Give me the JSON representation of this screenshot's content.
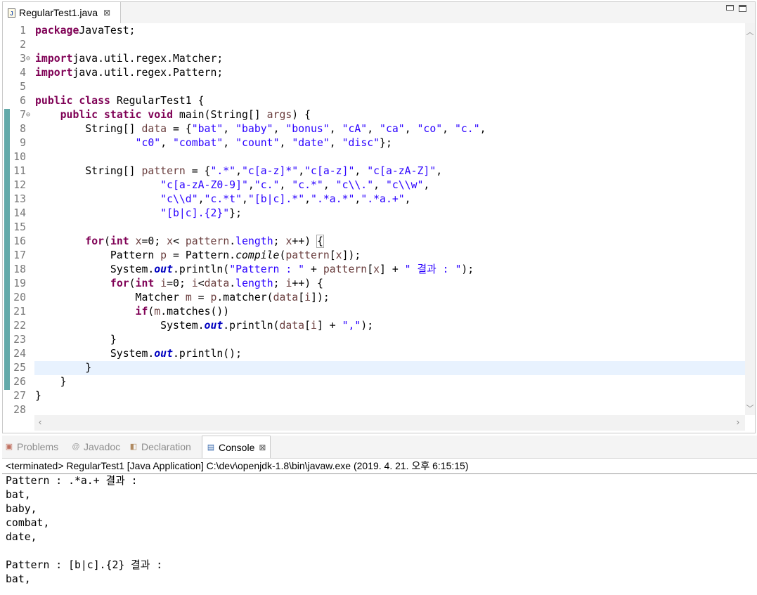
{
  "editor": {
    "tab_title": "RegularTest1.java",
    "lines": [
      {
        "n": "1",
        "fold": "",
        "segs": [
          [
            "kw",
            "package"
          ],
          [
            "",
            "JavaTest;"
          ]
        ]
      },
      {
        "n": "2",
        "fold": "",
        "segs": []
      },
      {
        "n": "3",
        "fold": "⊖",
        "segs": [
          [
            "kw",
            "import"
          ],
          [
            "",
            "java.util.regex.Matcher;"
          ]
        ]
      },
      {
        "n": "4",
        "fold": "",
        "segs": [
          [
            "kw",
            "import"
          ],
          [
            "",
            "java.util.regex.Pattern;"
          ]
        ]
      },
      {
        "n": "5",
        "fold": "",
        "segs": []
      },
      {
        "n": "6",
        "fold": "",
        "segs": [
          [
            "kw",
            "public class"
          ],
          [
            "",
            " RegularTest1 {"
          ]
        ]
      },
      {
        "n": "7",
        "fold": "⊖",
        "segs": [
          [
            "",
            "    "
          ],
          [
            "kw",
            "public static void"
          ],
          [
            "",
            " main(String[] "
          ],
          [
            "var",
            "args"
          ],
          [
            "",
            ") {"
          ]
        ]
      },
      {
        "n": "8",
        "fold": "",
        "segs": [
          [
            "",
            "        String[] "
          ],
          [
            "var",
            "data"
          ],
          [
            "",
            " = {"
          ],
          [
            "str",
            "\"bat\""
          ],
          [
            "",
            ", "
          ],
          [
            "str",
            "\"baby\""
          ],
          [
            "",
            ", "
          ],
          [
            "str",
            "\"bonus\""
          ],
          [
            "",
            ", "
          ],
          [
            "str",
            "\"cA\""
          ],
          [
            "",
            ", "
          ],
          [
            "str",
            "\"ca\""
          ],
          [
            "",
            ", "
          ],
          [
            "str",
            "\"co\""
          ],
          [
            "",
            ", "
          ],
          [
            "str",
            "\"c.\""
          ],
          [
            "",
            ","
          ]
        ]
      },
      {
        "n": "9",
        "fold": "",
        "segs": [
          [
            "",
            "                "
          ],
          [
            "str",
            "\"c0\""
          ],
          [
            "",
            ", "
          ],
          [
            "str",
            "\"combat\""
          ],
          [
            "",
            ", "
          ],
          [
            "str",
            "\"count\""
          ],
          [
            "",
            ", "
          ],
          [
            "str",
            "\"date\""
          ],
          [
            "",
            ", "
          ],
          [
            "str",
            "\"disc\""
          ],
          [
            "",
            "};"
          ]
        ]
      },
      {
        "n": "10",
        "fold": "",
        "segs": []
      },
      {
        "n": "11",
        "fold": "",
        "segs": [
          [
            "",
            "        String[] "
          ],
          [
            "var",
            "pattern"
          ],
          [
            "",
            " = {"
          ],
          [
            "str",
            "\".*\""
          ],
          [
            "",
            ","
          ],
          [
            "str",
            "\"c[a-z]*\""
          ],
          [
            "",
            ","
          ],
          [
            "str",
            "\"c[a-z]\""
          ],
          [
            "",
            ", "
          ],
          [
            "str",
            "\"c[a-zA-Z]\""
          ],
          [
            "",
            ","
          ]
        ]
      },
      {
        "n": "12",
        "fold": "",
        "segs": [
          [
            "",
            "                    "
          ],
          [
            "str",
            "\"c[a-zA-Z0-9]\""
          ],
          [
            "",
            ","
          ],
          [
            "str",
            "\"c.\""
          ],
          [
            "",
            ", "
          ],
          [
            "str",
            "\"c.*\""
          ],
          [
            "",
            ", "
          ],
          [
            "str",
            "\"c\\\\.\""
          ],
          [
            "",
            ", "
          ],
          [
            "str",
            "\"c\\\\w\""
          ],
          [
            "",
            ","
          ]
        ]
      },
      {
        "n": "13",
        "fold": "",
        "segs": [
          [
            "",
            "                    "
          ],
          [
            "str",
            "\"c\\\\d\""
          ],
          [
            "",
            ","
          ],
          [
            "str",
            "\"c.*t\""
          ],
          [
            "",
            ","
          ],
          [
            "str",
            "\"[b|c].*\""
          ],
          [
            "",
            ","
          ],
          [
            "str",
            "\".*a.*\""
          ],
          [
            "",
            ","
          ],
          [
            "str",
            "\".*a.+\""
          ],
          [
            "",
            ","
          ]
        ]
      },
      {
        "n": "14",
        "fold": "",
        "segs": [
          [
            "",
            "                    "
          ],
          [
            "str",
            "\"[b|c].{2}\""
          ],
          [
            "",
            "};"
          ]
        ]
      },
      {
        "n": "15",
        "fold": "",
        "segs": []
      },
      {
        "n": "16",
        "fold": "",
        "segs": [
          [
            "",
            "        "
          ],
          [
            "kw",
            "for"
          ],
          [
            "",
            "("
          ],
          [
            "kw",
            "int"
          ],
          [
            "",
            ""
          ],
          [
            "var",
            " x"
          ],
          [
            "",
            "=0; "
          ],
          [
            "var",
            "x"
          ],
          [
            "",
            "< "
          ],
          [
            "var",
            "pattern"
          ],
          [
            "",
            "."
          ],
          [
            "fldp",
            "length"
          ],
          [
            "",
            "; "
          ],
          [
            "var",
            "x"
          ],
          [
            "",
            "++) "
          ],
          [
            "brk",
            "{"
          ]
        ]
      },
      {
        "n": "17",
        "fold": "",
        "segs": [
          [
            "",
            "            Pattern "
          ],
          [
            "var",
            "p"
          ],
          [
            "",
            " = Pattern."
          ],
          [
            "ital",
            "compile"
          ],
          [
            "",
            "("
          ],
          [
            "var",
            "pattern"
          ],
          [
            "",
            "["
          ],
          [
            "var",
            "x"
          ],
          [
            "",
            "]);"
          ]
        ]
      },
      {
        "n": "18",
        "fold": "",
        "segs": [
          [
            "",
            "            System."
          ],
          [
            "fld",
            "out"
          ],
          [
            "",
            ".println("
          ],
          [
            "str",
            "\"Pattern : \""
          ],
          [
            "",
            " + "
          ],
          [
            "var",
            "pattern"
          ],
          [
            "",
            "["
          ],
          [
            "var",
            "x"
          ],
          [
            "",
            "] + "
          ],
          [
            "str",
            "\" 결과 : \""
          ],
          [
            "",
            ");"
          ]
        ]
      },
      {
        "n": "19",
        "fold": "",
        "segs": [
          [
            "",
            "            "
          ],
          [
            "kw",
            "for"
          ],
          [
            "",
            "("
          ],
          [
            "kw",
            "int"
          ],
          [
            "",
            ""
          ],
          [
            "var",
            " i"
          ],
          [
            "",
            "=0; "
          ],
          [
            "var",
            "i"
          ],
          [
            "",
            "<"
          ],
          [
            "var",
            "data"
          ],
          [
            "",
            "."
          ],
          [
            "fldp",
            "length"
          ],
          [
            "",
            "; "
          ],
          [
            "var",
            "i"
          ],
          [
            "",
            "++) {"
          ]
        ]
      },
      {
        "n": "20",
        "fold": "",
        "segs": [
          [
            "",
            "                Matcher "
          ],
          [
            "var",
            "m"
          ],
          [
            "",
            " = "
          ],
          [
            "var",
            "p"
          ],
          [
            "",
            ".matcher("
          ],
          [
            "var",
            "data"
          ],
          [
            "",
            "["
          ],
          [
            "var",
            "i"
          ],
          [
            "",
            "]);"
          ]
        ]
      },
      {
        "n": "21",
        "fold": "",
        "segs": [
          [
            "",
            "                "
          ],
          [
            "kw",
            "if"
          ],
          [
            "",
            "("
          ],
          [
            "var",
            "m"
          ],
          [
            "",
            ".matches())"
          ]
        ]
      },
      {
        "n": "22",
        "fold": "",
        "segs": [
          [
            "",
            "                    System."
          ],
          [
            "fld",
            "out"
          ],
          [
            "",
            ".println("
          ],
          [
            "var",
            "data"
          ],
          [
            "",
            "["
          ],
          [
            "var",
            "i"
          ],
          [
            "",
            "] + "
          ],
          [
            "str",
            "\",\""
          ],
          [
            "",
            ");"
          ]
        ]
      },
      {
        "n": "23",
        "fold": "",
        "segs": [
          [
            "",
            "            }"
          ]
        ]
      },
      {
        "n": "24",
        "fold": "",
        "segs": [
          [
            "",
            "            System."
          ],
          [
            "fld",
            "out"
          ],
          [
            "",
            ".println();"
          ]
        ]
      },
      {
        "n": "25",
        "fold": "",
        "segs": [
          [
            "",
            "        }"
          ]
        ]
      },
      {
        "n": "26",
        "fold": "",
        "segs": [
          [
            "",
            "    }"
          ]
        ]
      },
      {
        "n": "27",
        "fold": "",
        "segs": [
          [
            "",
            "}"
          ]
        ]
      },
      {
        "n": "28",
        "fold": "",
        "segs": []
      }
    ]
  },
  "views": {
    "tabs": [
      {
        "label": "Problems",
        "icon": "problems-icon",
        "glyph": "▣",
        "active": false
      },
      {
        "label": "Javadoc",
        "icon": "javadoc-icon",
        "glyph": "@",
        "active": false
      },
      {
        "label": "Declaration",
        "icon": "declaration-icon",
        "glyph": "◧",
        "active": false
      },
      {
        "label": "Console",
        "icon": "console-icon",
        "glyph": "▤",
        "active": true
      }
    ]
  },
  "console": {
    "status": "<terminated> RegularTest1 [Java Application] C:\\dev\\openjdk-1.8\\bin\\javaw.exe (2019. 4. 21. 오후 6:15:15)",
    "output": [
      "Pattern : .*a.+ 결과 :",
      "bat,",
      "baby,",
      "combat,",
      "date,",
      "",
      "Pattern : [b|c].{2} 결과 :",
      "bat,"
    ]
  },
  "colors": {
    "keyword": "#7f0055",
    "string": "#2a00ff",
    "variable": "#6a3e3e",
    "field": "#0000c0",
    "change_bar": "#63a9a9",
    "current_line": "#e8f2fe"
  },
  "icons": [
    "java-file-icon",
    "close-icon",
    "minimize-icon",
    "maximize-icon",
    "fold-icon",
    "problems-icon",
    "javadoc-icon",
    "declaration-icon",
    "console-icon",
    "scroll-up-icon",
    "scroll-down-icon",
    "scroll-left-icon",
    "scroll-right-icon"
  ]
}
